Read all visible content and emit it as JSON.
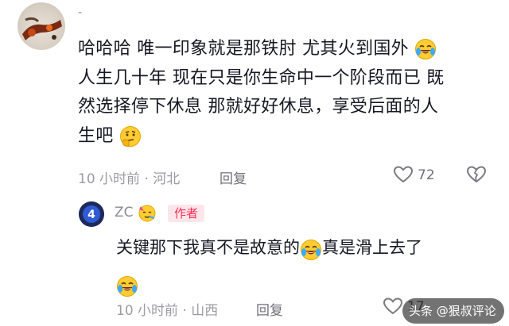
{
  "comment": {
    "username": "-",
    "text_lines": [
      "哈哈哈 唯一印象就是那铁肘 尤其火到国外",
      "人生几十年 现在只是你生命中一个阶段而已 既",
      "然选择停下休息 那就好好休息，享受后面的人",
      "生吧"
    ],
    "emoji_1": "crying-laughing-emoji",
    "emoji_2": "thinking-emoji",
    "time": "10 小时前",
    "separator": "·",
    "location": "河北",
    "reply_label": "回复",
    "like_count": "72"
  },
  "reply": {
    "avatar_text": "4",
    "nickname": "ZC",
    "badge": "作者",
    "text_part1": "关键那下我真不是故意的",
    "text_part2": "真是滑上去了",
    "time": "10 小时前",
    "separator": "·",
    "location": "山西",
    "reply_label": "回复",
    "like_count": "17"
  },
  "watermark": {
    "source": "头条",
    "account": "@狠叔评论"
  },
  "colors": {
    "accent": "#fe2c55",
    "meta_gray": "#9b9ca2",
    "emoji_yellow": "#ffcc33"
  }
}
